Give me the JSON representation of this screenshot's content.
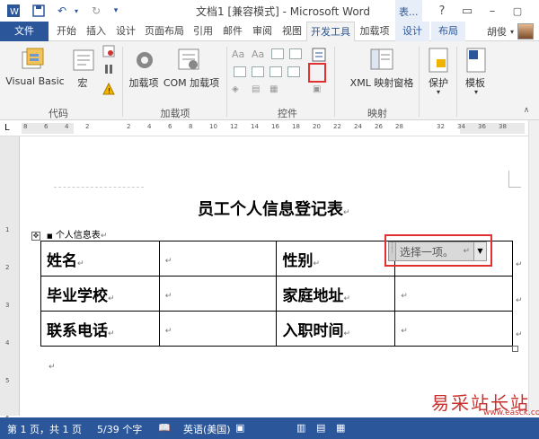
{
  "title_bar": {
    "title": "文档1 [兼容模式] - Microsoft Word",
    "context_tab_group": "表..."
  },
  "tabs": [
    "文件",
    "开始",
    "插入",
    "设计",
    "页面布局",
    "引用",
    "邮件",
    "审阅",
    "视图",
    "开发工具",
    "加载项",
    "设计",
    "布局"
  ],
  "active_tab": "开发工具",
  "user_name": "胡俊",
  "ribbon": {
    "groups": {
      "code": "代码",
      "addins": "加载项",
      "controls": "控件",
      "mapping": "映射"
    },
    "buttons": {
      "visual_basic": "Visual Basic",
      "macros": "宏",
      "addins": "加载项",
      "com_addins": "COM 加载项",
      "xml_mapping": "XML 映射窗格",
      "protect": "保护",
      "templates": "模板"
    }
  },
  "ruler": {
    "ticks": [
      "8",
      "6",
      "4",
      "2",
      "",
      "2",
      "4",
      "6",
      "8",
      "10",
      "12",
      "14",
      "16",
      "18",
      "20",
      "22",
      "24",
      "26",
      "28",
      "",
      "32",
      "34",
      "36",
      "38"
    ]
  },
  "vruler": {
    "ticks": [
      "1",
      "2",
      "3",
      "4",
      "5",
      "6"
    ]
  },
  "document": {
    "title": "员工个人信息登记表",
    "caption": "个人信息表",
    "table": [
      [
        "姓名",
        "",
        "性别",
        ""
      ],
      [
        "毕业学校",
        "",
        "家庭地址",
        ""
      ],
      [
        "联系电话",
        "",
        "入职时间",
        ""
      ]
    ],
    "dropdown_control_text": "选择一项。"
  },
  "status_bar": {
    "page": "第 1 页，共 1 页",
    "words": "5/39 个字",
    "language": "英语(美国)"
  },
  "watermark": {
    "text": "易采站长站",
    "url": "www.easck.com"
  }
}
